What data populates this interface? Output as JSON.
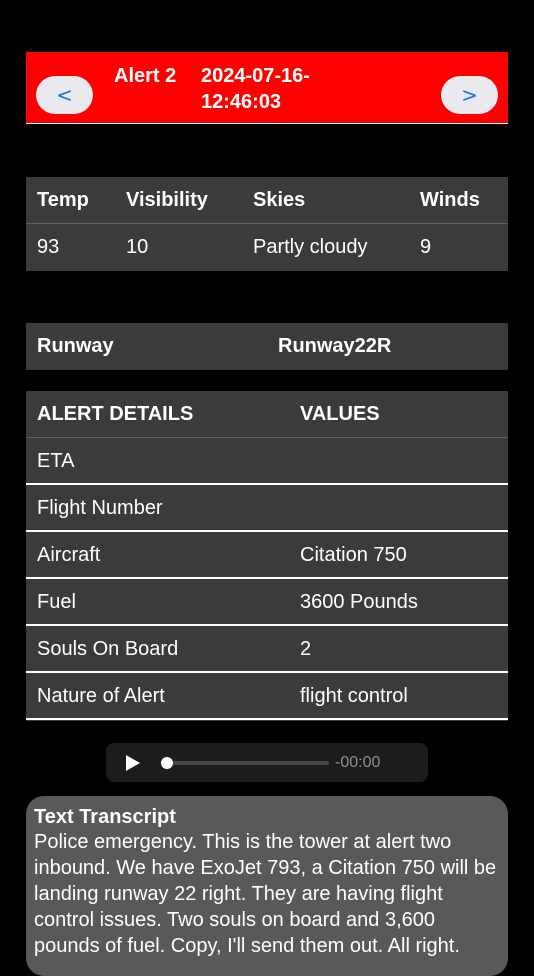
{
  "header": {
    "prev_label": "<",
    "next_label": ">",
    "alert_label": "Alert 2",
    "date": "2024-07-16-12:46:03",
    "color": "#ff0000"
  },
  "weather": {
    "headers": [
      "Temp",
      "Visibility",
      "Skies",
      "Winds"
    ],
    "values": [
      "93",
      "10",
      "Partly cloudy",
      "9"
    ]
  },
  "runway": {
    "label": "Runway",
    "value": "Runway22R"
  },
  "details": {
    "header_left": "ALERT DETAILS",
    "header_right": "VALUES",
    "rows": [
      {
        "label": "ETA",
        "value": ""
      },
      {
        "label": "Flight Number",
        "value": ""
      },
      {
        "label": "Aircraft",
        "value": "Citation 750"
      },
      {
        "label": "Fuel",
        "value": "3600 Pounds"
      },
      {
        "label": "Souls On Board",
        "value": "2"
      },
      {
        "label": "Nature of Alert",
        "value": "flight control"
      }
    ]
  },
  "audio": {
    "time": "-00:00",
    "progress": 0,
    "play_icon": "play-icon"
  },
  "transcript": {
    "title": "Text Transcript",
    "text": "Police emergency. This is the tower at alert two inbound. We have ExoJet 793, a Citation 750 will be landing runway 22 right. They are having flight control issues. Two souls on board and 3,600 pounds of fuel. Copy, I'll send them out. All right."
  }
}
